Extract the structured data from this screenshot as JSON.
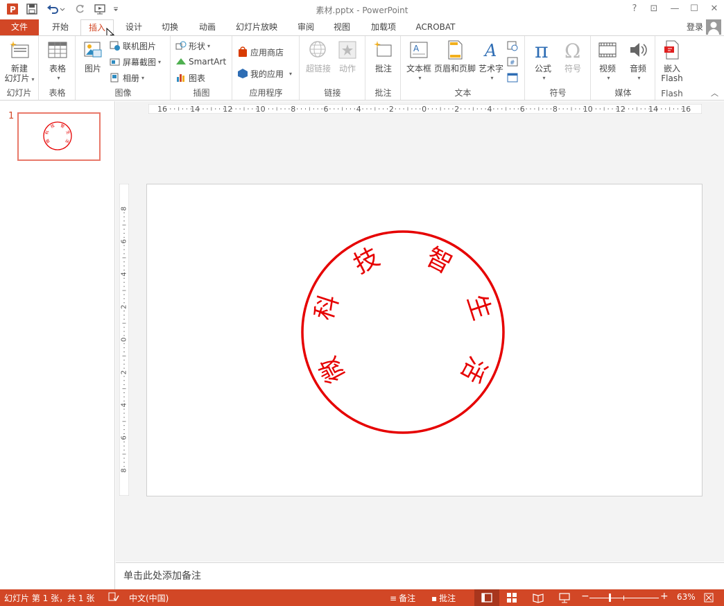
{
  "app": {
    "window_title": "素材.pptx - PowerPoint",
    "help_glyph": "?",
    "ribbon_display_glyph": "⊡",
    "minimize_glyph": "—",
    "maximize_glyph": "☐",
    "close_glyph": "✕",
    "login": "登录"
  },
  "tabs": [
    {
      "label": "文件"
    },
    {
      "label": "开始"
    },
    {
      "label": "插入"
    },
    {
      "label": "设计"
    },
    {
      "label": "切换"
    },
    {
      "label": "动画"
    },
    {
      "label": "幻灯片放映"
    },
    {
      "label": "审阅"
    },
    {
      "label": "视图"
    },
    {
      "label": "加载项"
    },
    {
      "label": "ACROBAT"
    }
  ],
  "ribbon": {
    "groups": {
      "slides": "幻灯片",
      "tables": "表格",
      "images": "图像",
      "illustrations": "插图",
      "apps": "应用程序",
      "links": "链接",
      "comments": "批注",
      "text": "文本",
      "symbols": "符号",
      "media": "媒体",
      "flash": "Flash"
    },
    "new_slide_line1": "新建",
    "new_slide_line2": "幻灯片",
    "table": "表格",
    "picture": "图片",
    "online_pictures": "联机图片",
    "screenshot": "屏幕截图",
    "photo_album": "相册",
    "shapes": "形状",
    "smartart": "SmartArt",
    "chart": "图表",
    "store": "应用商店",
    "my_apps": "我的应用",
    "hyperlink": "超链接",
    "action": "动作",
    "comment": "批注",
    "textbox": "文本框",
    "header_footer": "页眉和页脚",
    "wordart": "艺术字",
    "equation": "公式",
    "symbol": "符号",
    "video": "视频",
    "audio": "音频",
    "embed_line1": "嵌入",
    "embed_line2": "Flash"
  },
  "ruler": {
    "horizontal": [
      "16",
      "14",
      "12",
      "10",
      "8",
      "6",
      "4",
      "2",
      "0",
      "2",
      "4",
      "6",
      "8",
      "10",
      "12",
      "14",
      "16"
    ],
    "vertical": [
      "8",
      "6",
      "4",
      "2",
      "0",
      "2",
      "4",
      "6",
      "8"
    ]
  },
  "thumbnail": {
    "number": "1"
  },
  "seal": {
    "color": "#e60000",
    "characters": [
      "微",
      "科",
      "技",
      "智",
      "生",
      "活"
    ]
  },
  "notes": {
    "placeholder": "单击此处添加备注"
  },
  "status": {
    "slide_info": "幻灯片 第 1 张，共 1 张",
    "language": "中文(中国)",
    "notes": "备注",
    "comments": "批注",
    "zoom": "63%"
  },
  "colors": {
    "accent": "#d24726",
    "thumb_border": "#e8796a"
  }
}
